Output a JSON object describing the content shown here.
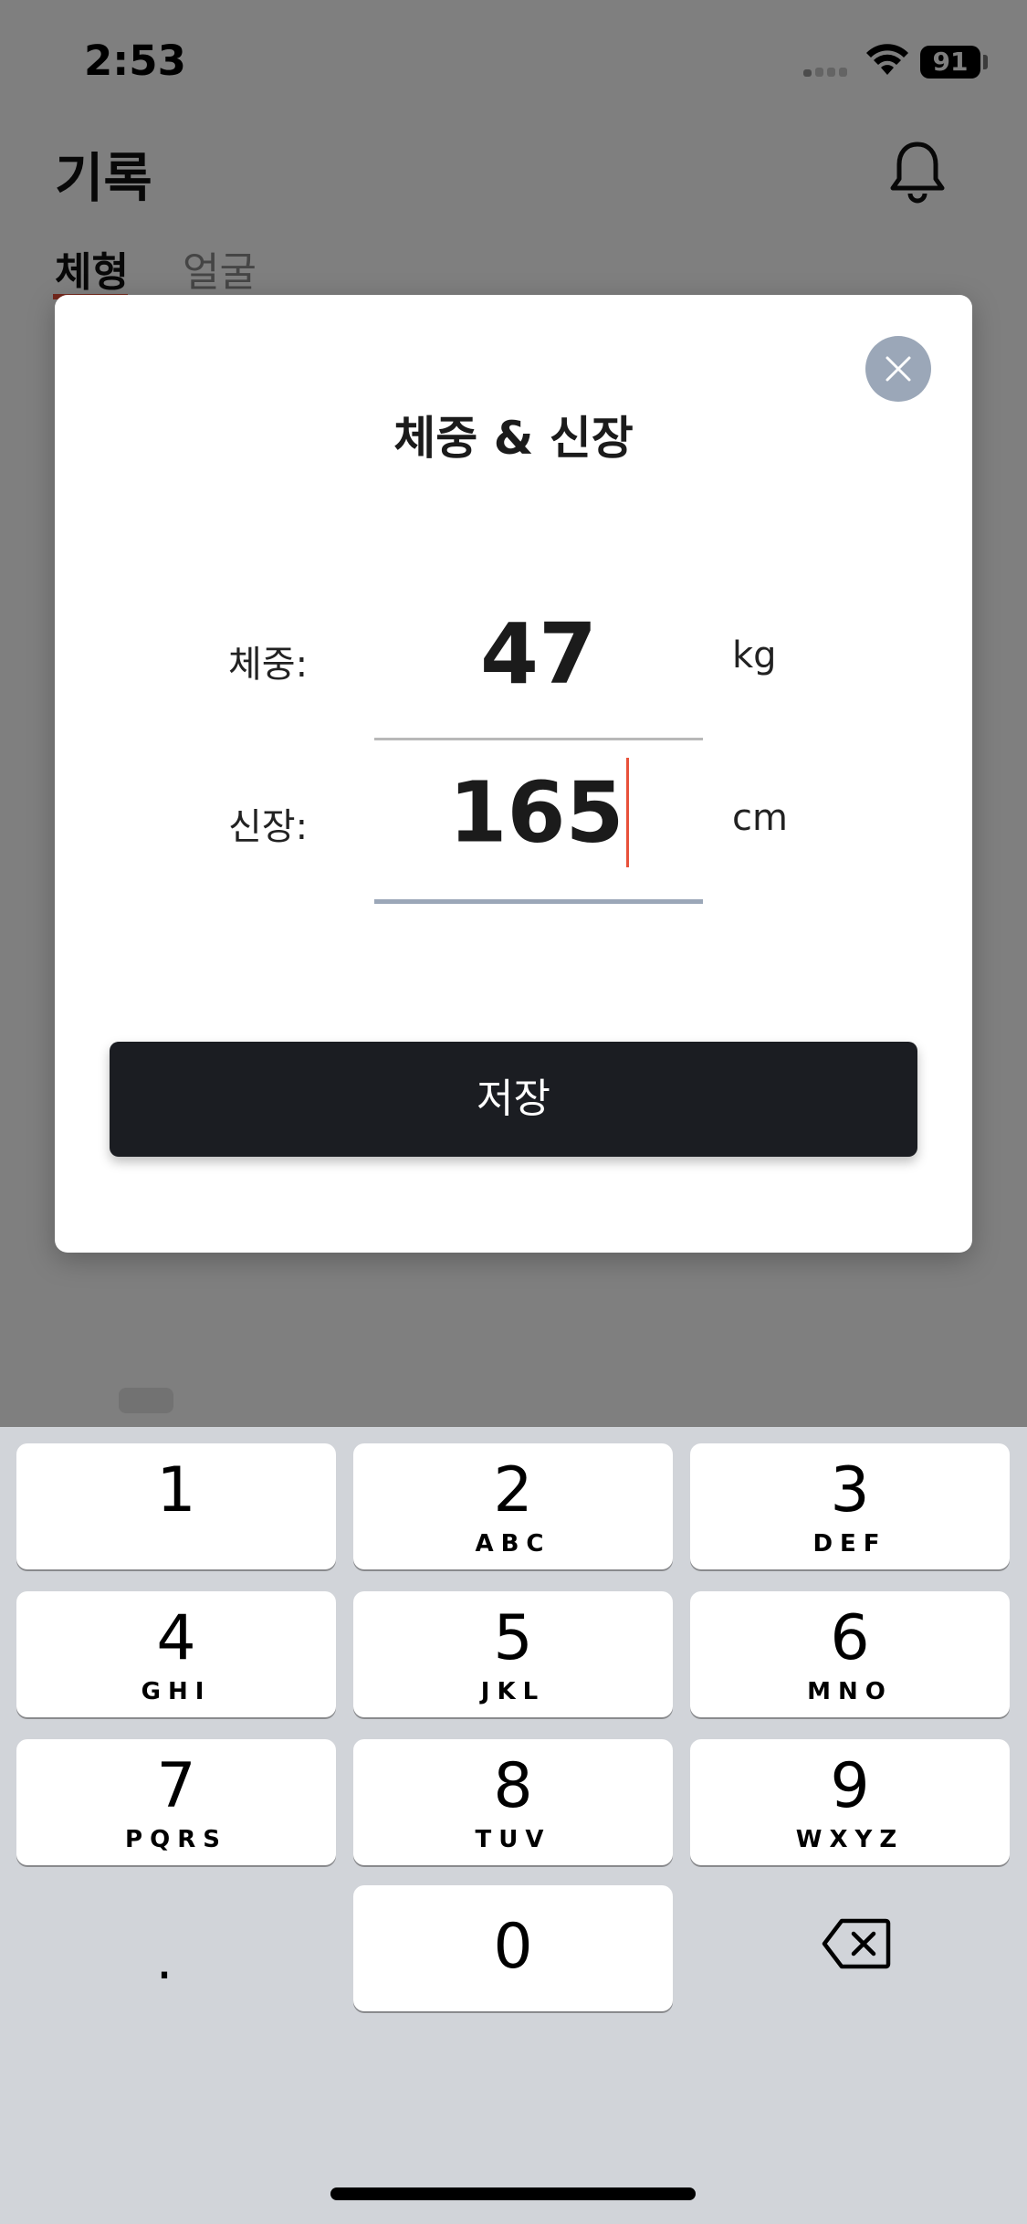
{
  "status_bar": {
    "time": "2:53",
    "battery": "91"
  },
  "header": {
    "title": "기록"
  },
  "tabs": [
    {
      "label": "체형",
      "active": true
    },
    {
      "label": "얼굴",
      "active": false
    }
  ],
  "modal": {
    "title": "체중 & 신장",
    "weight": {
      "label": "체중:",
      "value": "47",
      "unit": "kg"
    },
    "height": {
      "label": "신장:",
      "value": "165",
      "unit": "cm"
    },
    "save_label": "저장"
  },
  "keypad": {
    "keys": [
      {
        "num": "1",
        "sub": ""
      },
      {
        "num": "2",
        "sub": "ABC"
      },
      {
        "num": "3",
        "sub": "DEF"
      },
      {
        "num": "4",
        "sub": "GHI"
      },
      {
        "num": "5",
        "sub": "JKL"
      },
      {
        "num": "6",
        "sub": "MNO"
      },
      {
        "num": "7",
        "sub": "PQRS"
      },
      {
        "num": "8",
        "sub": "TUV"
      },
      {
        "num": "9",
        "sub": "WXYZ"
      },
      {
        "num": "0",
        "sub": ""
      }
    ],
    "decimal": "."
  },
  "colors": {
    "accent": "#e8513a",
    "button_dark": "#1b1d22",
    "close_button": "#9ba7b8",
    "keypad_bg": "#d1d4d9"
  }
}
